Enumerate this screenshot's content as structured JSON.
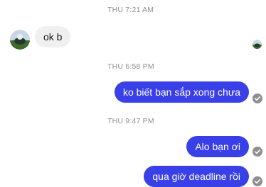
{
  "thread": {
    "timestamps": [
      "THU 7:21 AM",
      "THU 6:58 PM",
      "THU 9:47 PM"
    ],
    "incoming": {
      "text": "ok b"
    },
    "outgoing": [
      {
        "text": "ko biết bạn sắp xong chưa"
      },
      {
        "text": "Alo bạn ơi"
      },
      {
        "text": "qua giờ deadline rồi"
      }
    ]
  },
  "colors": {
    "outgoing_bubble": "#3a40e8",
    "incoming_bubble": "#f0f0f1",
    "timestamp_text": "#8c8f96",
    "read_indicator": "#8e8e93"
  },
  "icons": {
    "contact_avatar": "avatar-icon",
    "seen_avatar": "seen-avatar-icon",
    "delivered": "check-circle-icon"
  }
}
